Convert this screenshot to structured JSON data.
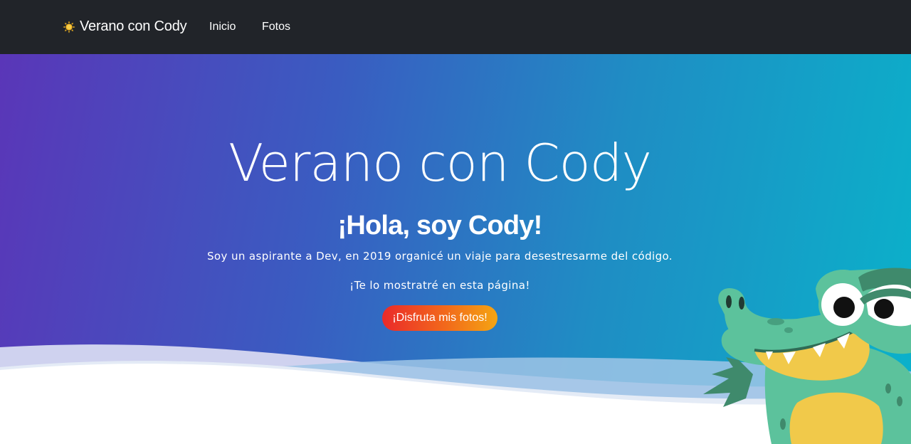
{
  "navbar": {
    "brand_label": "Verano con Cody",
    "brand_icon": "sun-icon",
    "links": [
      {
        "label": "Inicio"
      },
      {
        "label": "Fotos"
      }
    ]
  },
  "hero": {
    "title": "Verano con Cody",
    "subtitle": "¡Hola, soy Cody!",
    "paragraph_1": "Soy un aspirante a Dev, en 2019 organicé un viaje para desestresarme del código.",
    "paragraph_2": "¡Te lo mostratré en esta página!",
    "cta_label": "¡Disfruta mis fotos!",
    "mascot_icon": "crocodile-mascot"
  },
  "colors": {
    "navbar_bg": "#212429",
    "gradient_start": "#5a36b8",
    "gradient_end": "#0ab2ca",
    "cta_start": "#ea2a2a",
    "cta_end": "#f4a513",
    "mascot_green": "#5cc29c"
  }
}
